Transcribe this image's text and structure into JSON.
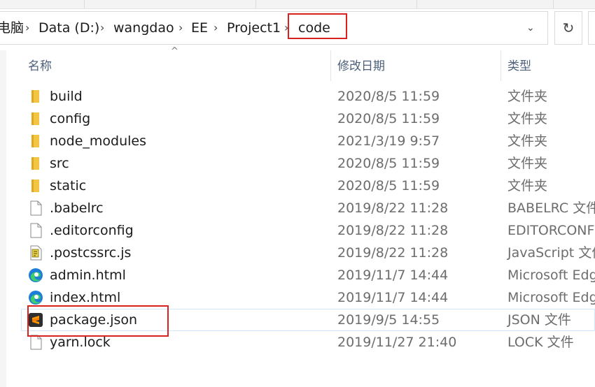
{
  "breadcrumb": {
    "items": [
      "电脑",
      "Data (D:)",
      "wangdao",
      "EE",
      "Project1",
      "code"
    ],
    "separator": "›"
  },
  "columns": {
    "name": "名称",
    "date": "修改日期",
    "type": "类型"
  },
  "files": [
    {
      "name": "build",
      "date": "2020/8/5 11:59",
      "type": "文件夹",
      "icon": "folder-icon"
    },
    {
      "name": "config",
      "date": "2020/8/5 11:59",
      "type": "文件夹",
      "icon": "folder-icon"
    },
    {
      "name": "node_modules",
      "date": "2021/3/19 9:57",
      "type": "文件夹",
      "icon": "folder-icon"
    },
    {
      "name": "src",
      "date": "2020/8/5 11:59",
      "type": "文件夹",
      "icon": "folder-icon"
    },
    {
      "name": "static",
      "date": "2020/8/5 11:59",
      "type": "文件夹",
      "icon": "folder-icon"
    },
    {
      "name": ".babelrc",
      "date": "2019/8/22 11:28",
      "type": "BABELRC 文件",
      "icon": "file-icon"
    },
    {
      "name": ".editorconfig",
      "date": "2019/8/22 11:28",
      "type": "EDITORCONFIG",
      "icon": "file-icon"
    },
    {
      "name": ".postcssrc.js",
      "date": "2019/8/22 11:28",
      "type": "JavaScript 文件",
      "icon": "script-file-icon"
    },
    {
      "name": "admin.html",
      "date": "2019/11/7 14:44",
      "type": "Microsoft Edge",
      "icon": "edge-icon"
    },
    {
      "name": "index.html",
      "date": "2019/11/7 14:44",
      "type": "Microsoft Edge",
      "icon": "edge-icon"
    },
    {
      "name": "package.json",
      "date": "2019/9/5 14:55",
      "type": "JSON 文件",
      "icon": "sublime-text-icon"
    },
    {
      "name": "yarn.lock",
      "date": "2019/11/27 21:40",
      "type": "LOCK 文件",
      "icon": "file-icon"
    }
  ],
  "colors": {
    "highlight": "#d9211e",
    "folder": "#f4c542",
    "header_text": "#4c607a",
    "hover_border": "#cde8ff"
  }
}
